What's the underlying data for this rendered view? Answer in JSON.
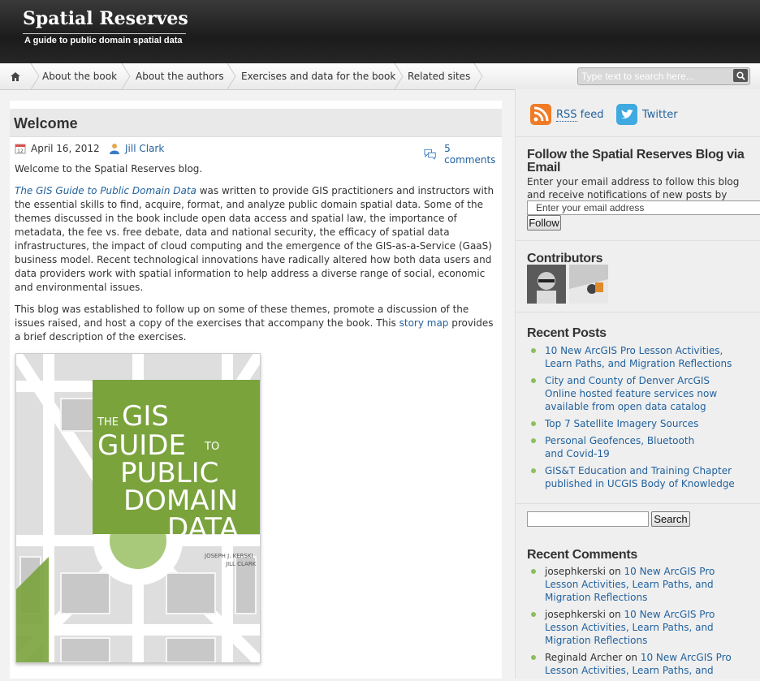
{
  "header": {
    "site_title": "Spatial Reserves",
    "tagline": "A guide to public domain spatial data"
  },
  "nav": {
    "home_icon": "home-icon",
    "items": [
      "About the book",
      "About the authors",
      "Exercises and data for the book",
      "Related sites"
    ],
    "search_placeholder": "Type text to search here..."
  },
  "post": {
    "title": "Welcome",
    "date": "April 16, 2012",
    "author": "Jill Clark",
    "comments": "5 comments",
    "intro": "Welcome to the Spatial Reserves blog.",
    "book_link": "The GIS Guide to Public Domain Data",
    "para1_rest": " was written to provide GIS practitioners and instructors with the essential skills to find, acquire, format, and analyze public domain spatial data. Some of the themes discussed in the book include open data access and spatial law, the importance of metadata, the fee vs. free debate, data and national security, the efficacy of spatial data infrastructures, the impact of cloud computing and the emergence of the GIS-as-a-Service (GaaS) business model. Recent technological innovations have radically altered how both data users and data providers work with spatial information to help address a diverse range of social, economic and environmental issues.",
    "para2_start": "This blog was established to follow up on some of these themes, promote a discussion of the issues raised, and host a copy of the exercises that accompany the book.  This ",
    "story_link": "story map",
    "para2_end": " provides a brief description of the exercises.",
    "book_cover": {
      "line1": "THE",
      "line2": "GIS",
      "line3": "GUIDE",
      "line4": "TO",
      "line5": "PUBLIC",
      "line6": "DOMAIN",
      "line7": "DATA",
      "author1": "JOSEPH J. KERSKI",
      "author2": "JILL CLARK",
      "green": "#7aa33c"
    }
  },
  "sidebar": {
    "rss": "RSS feed",
    "rss_abbr": "RSS",
    "rss_rest": " feed",
    "twitter": "Twitter",
    "follow_title": "Follow the Spatial Reserves Blog via Email",
    "follow_desc": "Enter your email address to follow this blog and receive notifications of new posts by email.",
    "email_placeholder": "Enter your email address",
    "follow_button": "Follow",
    "contributors_title": "Contributors",
    "recent_posts_title": "Recent Posts",
    "recent_posts": [
      "10 New ArcGIS Pro Lesson Activities, Learn Paths, and Migration Reflections",
      "City and County of Denver ArcGIS Online hosted feature services now available from open data catalog",
      "Top 7 Satellite Imagery Sources",
      "Personal Geofences, Bluetooth and Covid-19",
      "GIS&T Education and Training Chapter published in UCGIS Body of Knowledge"
    ],
    "search_button": "Search",
    "recent_comments_title": "Recent Comments",
    "recent_comments": [
      {
        "author": "josephkerski",
        "on": " on ",
        "post": "10 New ArcGIS Pro Lesson Activities, Learn Paths, and Migration Reflections"
      },
      {
        "author": "josephkerski",
        "on": " on ",
        "post": "10 New ArcGIS Pro Lesson Activities, Learn Paths, and Migration Reflections"
      },
      {
        "author": "Reginald Archer",
        "on": " on ",
        "post": "10 New ArcGIS Pro Lesson Activities, Learn Paths, and"
      }
    ]
  }
}
